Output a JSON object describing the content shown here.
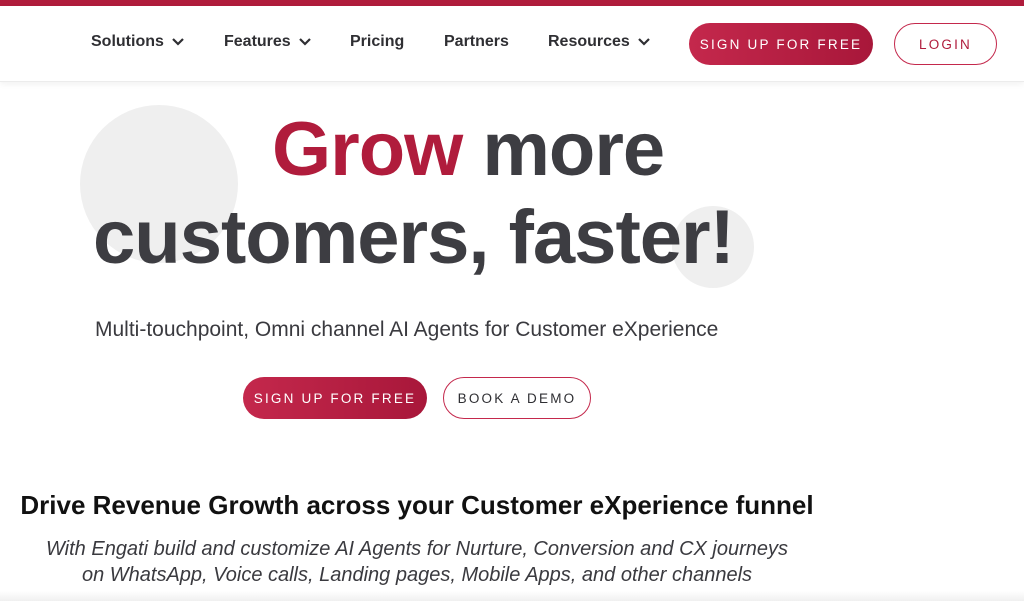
{
  "nav": {
    "items": [
      {
        "label": "Solutions",
        "has_dropdown": true
      },
      {
        "label": "Features",
        "has_dropdown": true
      },
      {
        "label": "Pricing",
        "has_dropdown": false
      },
      {
        "label": "Partners",
        "has_dropdown": false
      },
      {
        "label": "Resources",
        "has_dropdown": true
      }
    ],
    "signup_label": "SIGN UP FOR FREE",
    "login_label": "LOGIN"
  },
  "hero": {
    "accent_word": "Grow",
    "line1_rest": " more",
    "line2": "customers, faster!",
    "subtitle": "Multi-touchpoint, Omni channel AI Agents for Customer eXperience",
    "signup_label": "SIGN UP FOR FREE",
    "demo_label": "BOOK A DEMO"
  },
  "section": {
    "title": "Drive Revenue Growth across your Customer eXperience funnel",
    "desc_line1": "With Engati build and customize AI Agents for Nurture, Conversion and CX journeys",
    "desc_line2": "on WhatsApp, Voice calls, Landing pages, Mobile Apps, and other channels"
  },
  "colors": {
    "brand": "#b01c3c",
    "text_dark": "#3d3d42",
    "background": "#ffffff"
  },
  "icons": {
    "dropdown": "chevron-down-icon"
  }
}
